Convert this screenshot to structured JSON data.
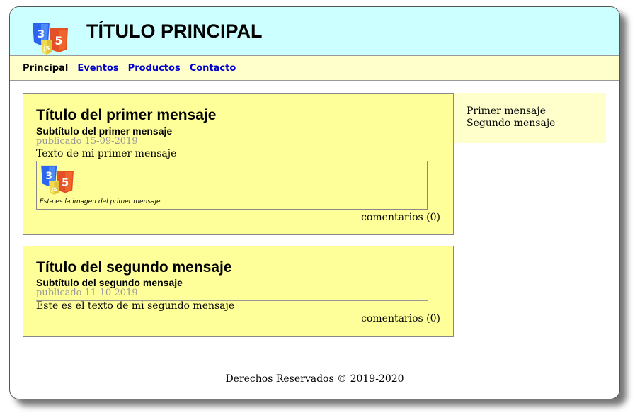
{
  "header": {
    "title": "TÍTULO PRINCIPAL",
    "logo_icon": "css-js-html-logo-icon"
  },
  "nav": {
    "items": [
      {
        "label": "Principal",
        "active": true
      },
      {
        "label": "Eventos",
        "active": false
      },
      {
        "label": "Productos",
        "active": false
      },
      {
        "label": "Contacto",
        "active": false
      }
    ]
  },
  "articles": [
    {
      "title": "Título del primer mensaje",
      "subtitle": "Subtítulo del primer mensaje",
      "date": "publicado 15-09-2019",
      "text": "Texto de mi primer mensaje",
      "image_icon": "css-js-html-logo-icon",
      "caption": "Esta es la imagen del primer mensaje",
      "comments": "comentarios (0)"
    },
    {
      "title": "Título del segundo mensaje",
      "subtitle": "Subtítulo del segundo mensaje",
      "date": "publicado 11-10-2019",
      "text": "Este es el texto de mi segundo mensaje",
      "comments": "comentarios (0)"
    }
  ],
  "aside": {
    "items": [
      "Primer mensaje",
      "Segundo mensaje"
    ]
  },
  "footer": {
    "text": "Derechos Reservados © 2019-2020"
  },
  "colors": {
    "header_bg": "#ccffff",
    "nav_bg": "#ffffcc",
    "article_bg": "#ffff99",
    "aside_bg": "#ffffcc",
    "link": "#0000cc",
    "date": "#999999"
  }
}
